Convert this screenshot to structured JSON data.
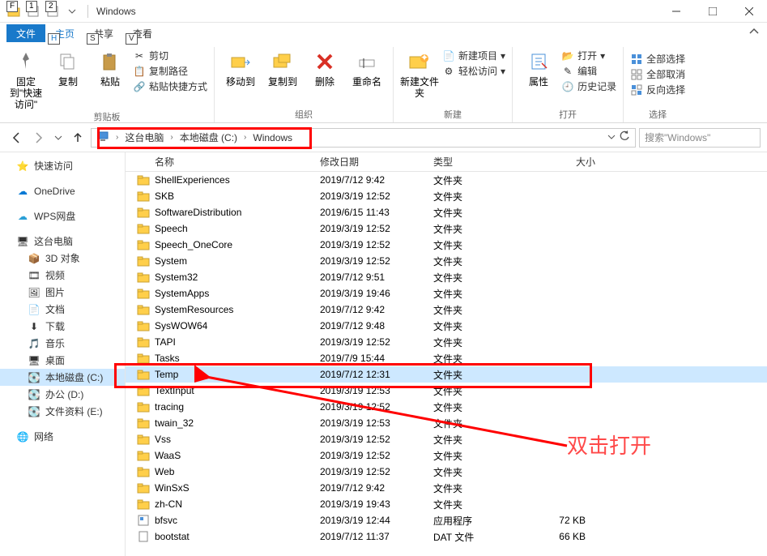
{
  "window": {
    "title": "Windows"
  },
  "qat_keytips": [
    "F",
    "1",
    "2"
  ],
  "tabs": {
    "file": "文件",
    "home": "主页",
    "share": "共享",
    "view": "查看",
    "tips": {
      "home": "H",
      "share": "S",
      "view": "V"
    }
  },
  "ribbon": {
    "clipboard": {
      "label": "剪贴板",
      "pin": "固定到\"快速访问\"",
      "copy": "复制",
      "paste": "粘贴",
      "cut": "剪切",
      "copypath": "复制路径",
      "pasteshortcut": "粘贴快捷方式"
    },
    "organize": {
      "label": "组织",
      "moveto": "移动到",
      "copyto": "复制到",
      "delete": "删除",
      "rename": "重命名"
    },
    "new": {
      "label": "新建",
      "newfolder": "新建文件夹",
      "newitem": "新建项目",
      "easyaccess": "轻松访问"
    },
    "open": {
      "label": "打开",
      "properties": "属性",
      "open": "打开",
      "edit": "编辑",
      "history": "历史记录"
    },
    "select": {
      "label": "选择",
      "selectall": "全部选择",
      "selectnone": "全部取消",
      "invert": "反向选择"
    }
  },
  "breadcrumbs": [
    "这台电脑",
    "本地磁盘 (C:)",
    "Windows"
  ],
  "search": {
    "placeholder": "搜索\"Windows\""
  },
  "sidebar": {
    "quick": "快速访问",
    "onedrive": "OneDrive",
    "wps": "WPS网盘",
    "pc": "这台电脑",
    "objects3d": "3D 对象",
    "videos": "视频",
    "pictures": "图片",
    "documents": "文档",
    "downloads": "下载",
    "music": "音乐",
    "desktop": "桌面",
    "cdrive": "本地磁盘 (C:)",
    "ddrive": "办公 (D:)",
    "edrive": "文件资料 (E:)",
    "network": "网络"
  },
  "cols": {
    "name": "名称",
    "date": "修改日期",
    "type": "类型",
    "size": "大小"
  },
  "typedir": "文件夹",
  "typeapp": "应用程序",
  "typedat": "DAT 文件",
  "files": [
    {
      "n": "ShellExperiences",
      "d": "2019/7/12 9:42",
      "t": "dir"
    },
    {
      "n": "SKB",
      "d": "2019/3/19 12:52",
      "t": "dir"
    },
    {
      "n": "SoftwareDistribution",
      "d": "2019/6/15 11:43",
      "t": "dir"
    },
    {
      "n": "Speech",
      "d": "2019/3/19 12:52",
      "t": "dir"
    },
    {
      "n": "Speech_OneCore",
      "d": "2019/3/19 12:52",
      "t": "dir"
    },
    {
      "n": "System",
      "d": "2019/3/19 12:52",
      "t": "dir"
    },
    {
      "n": "System32",
      "d": "2019/7/12 9:51",
      "t": "dir"
    },
    {
      "n": "SystemApps",
      "d": "2019/3/19 19:46",
      "t": "dir"
    },
    {
      "n": "SystemResources",
      "d": "2019/7/12 9:42",
      "t": "dir"
    },
    {
      "n": "SysWOW64",
      "d": "2019/7/12 9:48",
      "t": "dir"
    },
    {
      "n": "TAPI",
      "d": "2019/3/19 12:52",
      "t": "dir"
    },
    {
      "n": "Tasks",
      "d": "2019/7/9 15:44",
      "t": "dir"
    },
    {
      "n": "Temp",
      "d": "2019/7/12 12:31",
      "t": "dir",
      "sel": true
    },
    {
      "n": "TextInput",
      "d": "2019/3/19 12:53",
      "t": "dir"
    },
    {
      "n": "tracing",
      "d": "2019/3/19 12:52",
      "t": "dir"
    },
    {
      "n": "twain_32",
      "d": "2019/3/19 12:53",
      "t": "dir"
    },
    {
      "n": "Vss",
      "d": "2019/3/19 12:52",
      "t": "dir"
    },
    {
      "n": "WaaS",
      "d": "2019/3/19 12:52",
      "t": "dir"
    },
    {
      "n": "Web",
      "d": "2019/3/19 12:52",
      "t": "dir"
    },
    {
      "n": "WinSxS",
      "d": "2019/7/12 9:42",
      "t": "dir"
    },
    {
      "n": "zh-CN",
      "d": "2019/3/19 19:43",
      "t": "dir"
    },
    {
      "n": "bfsvc",
      "d": "2019/3/19 12:44",
      "t": "app",
      "s": "72 KB"
    },
    {
      "n": "bootstat",
      "d": "2019/7/12 11:37",
      "t": "dat",
      "s": "66 KB"
    }
  ],
  "annotation": {
    "text": "双击打开"
  }
}
